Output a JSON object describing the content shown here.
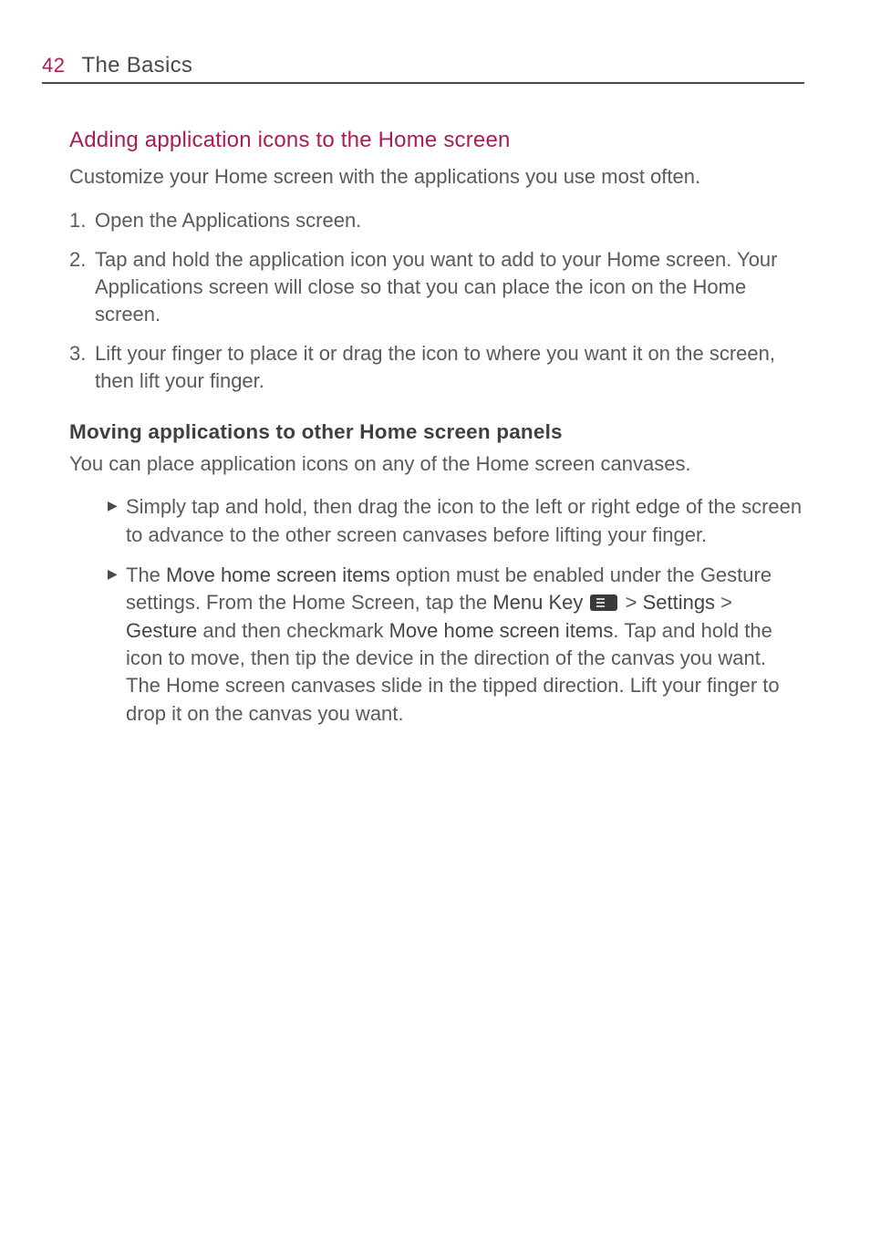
{
  "header": {
    "pageNumber": "42",
    "chapterTitle": "The Basics"
  },
  "s1": {
    "heading": "Adding application icons to the Home screen",
    "intro": "Customize your Home screen with the applications you use most often.",
    "li1": "Open the Applications screen.",
    "li2": "Tap and hold the application icon you want to add to your Home screen. Your Applications screen will close so that you can place the icon on the Home screen.",
    "li3": "Lift your finger to place it or drag the icon to where you want it on the screen, then lift your finger."
  },
  "s2": {
    "heading": "Moving applications to other Home screen panels",
    "intro": "You can place application icons on any of the Home screen canvases.",
    "b1": "Simply tap and hold, then drag the icon to the left or right edge of the screen to advance to the other screen canvases before lifting your finger.",
    "b2a": "The ",
    "b2b": "Move home screen items",
    "b2c": " option must be enabled under the Gesture settings. From the Home Screen, tap the ",
    "b2d": "Menu Key",
    "b2e": " > ",
    "b2f": "Settings",
    "b2g": " > ",
    "b2h": "Gesture",
    "b2i": " and then checkmark ",
    "b2j": "Move home screen items",
    "b2k": ". Tap and hold the icon to move, then tip the device in the direction of the canvas you want. The Home screen canvases slide in the tipped direction. Lift your finger to drop it on the canvas you want."
  }
}
